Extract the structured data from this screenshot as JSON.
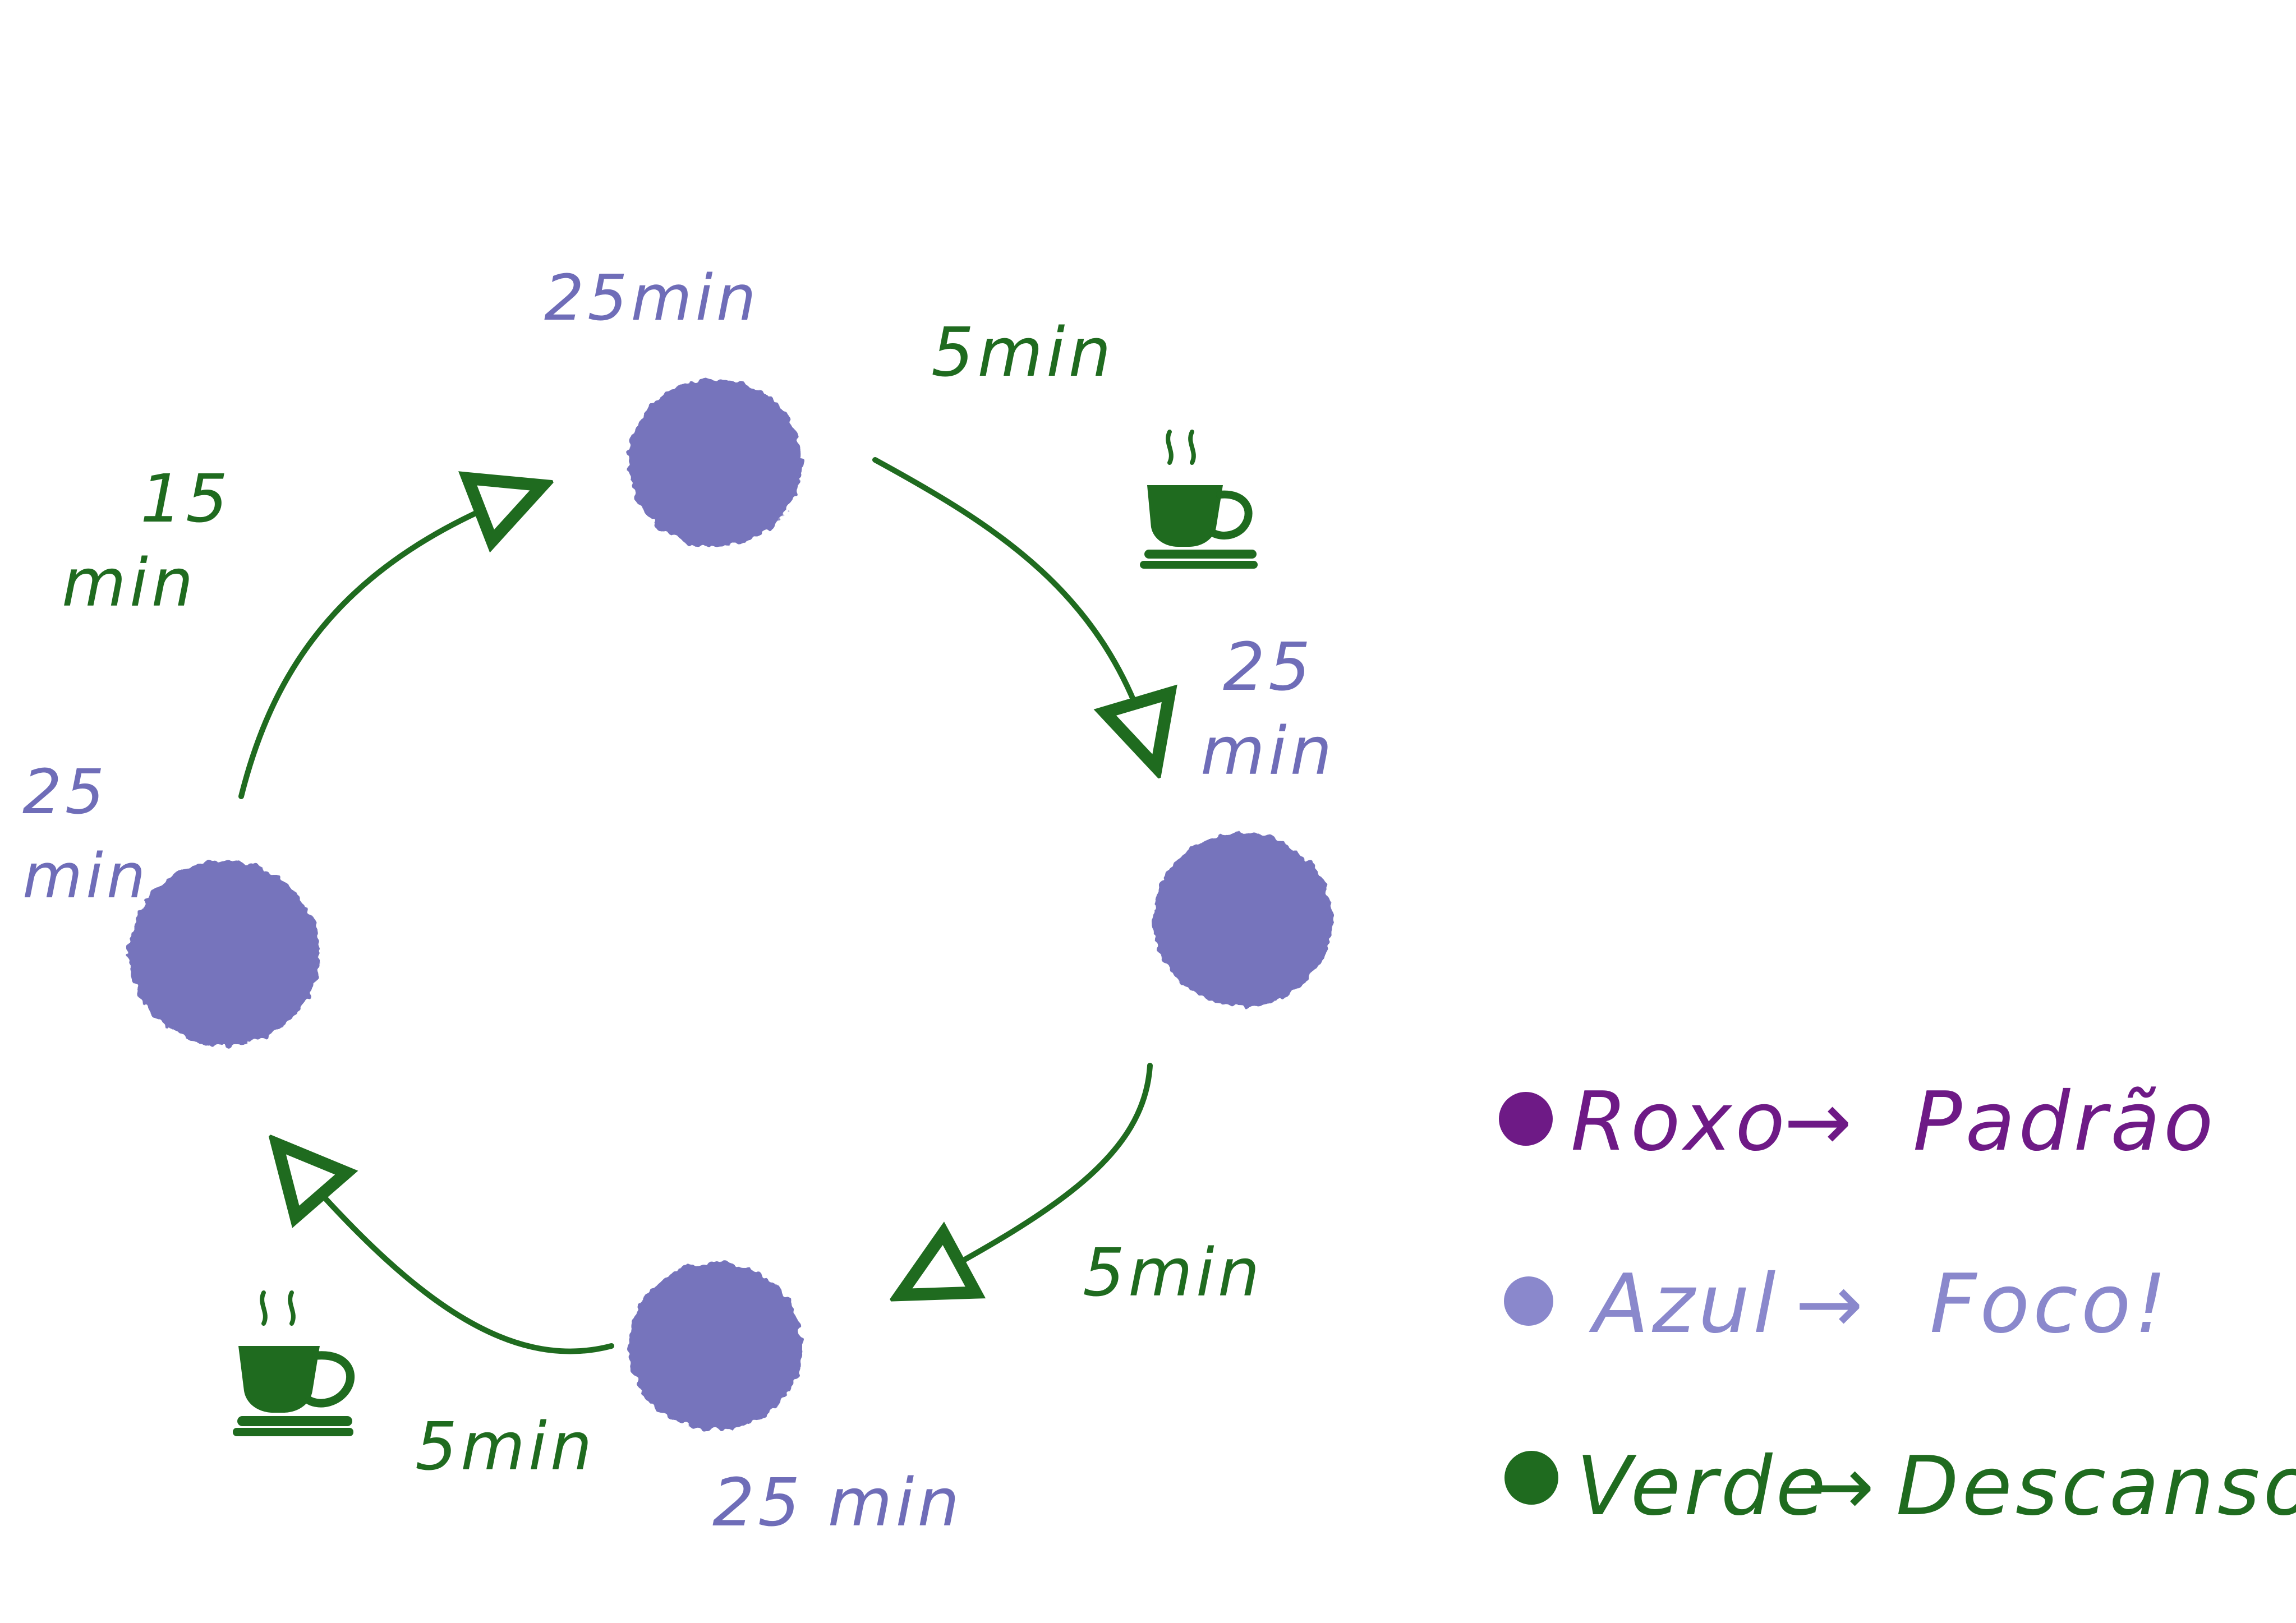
{
  "colors": {
    "focus": "#6f6db8",
    "rest": "#1f6b1f",
    "default": "#6e1a86",
    "legend_focus": "#8a88cc"
  },
  "labels": {
    "top_focus": "25min",
    "top_right_rest": "5min",
    "right_focus_line1": "25",
    "right_focus_line2": "min",
    "left_rest_line1": "15",
    "left_rest_line2": "min",
    "left_focus_line1": "25",
    "left_focus_line2": "min",
    "bottom_right_rest": "5min",
    "bottom_left_rest": "5min",
    "bottom_focus": "25 min"
  },
  "legend": [
    {
      "color_name": "Roxo",
      "arrow": "→",
      "meaning": "Padrão",
      "dot_color": "#6e1a86"
    },
    {
      "color_name": "Azul",
      "arrow": "→",
      "meaning": "Foco!",
      "dot_color": "#8a88cc"
    },
    {
      "color_name": "Verde",
      "arrow": "→",
      "meaning": "Descanso",
      "dot_color": "#1f6b1f"
    }
  ],
  "icons": {
    "coffee": "coffee-cup-icon"
  }
}
